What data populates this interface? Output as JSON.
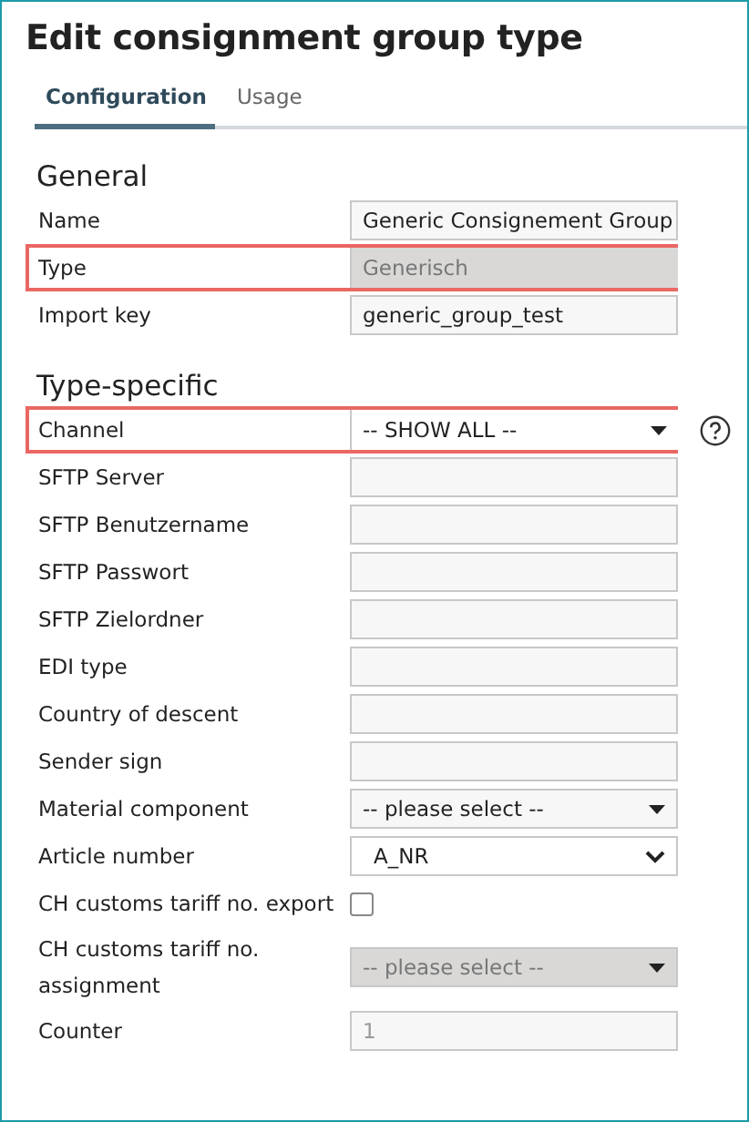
{
  "title": "Edit consignment group type",
  "tabs": [
    {
      "label": "Configuration",
      "selected": true
    },
    {
      "label": "Usage",
      "selected": false
    }
  ],
  "sections": [
    {
      "title": "General",
      "rows": [
        {
          "label": "Name",
          "kind": "text",
          "value": "Generic Consignement Group",
          "disabled": false,
          "readonly": false,
          "highlighted": false,
          "help": false
        },
        {
          "label": "Type",
          "kind": "text",
          "value": "Generisch",
          "disabled": true,
          "readonly": false,
          "highlighted": true,
          "help": false
        },
        {
          "label": "Import key",
          "kind": "text",
          "value": "generic_group_test",
          "disabled": false,
          "readonly": false,
          "highlighted": false,
          "help": false
        }
      ]
    },
    {
      "title": "Type-specific",
      "rows": [
        {
          "label": "Channel",
          "kind": "select",
          "value": "-- SHOW ALL --",
          "disabled": false,
          "highlighted": true,
          "help": true
        },
        {
          "label": "SFTP Server",
          "kind": "text",
          "disabled": false,
          "highlighted": false,
          "help": false
        },
        {
          "label": "SFTP Benutzername",
          "kind": "text",
          "disabled": false,
          "highlighted": false,
          "help": false
        },
        {
          "label": "SFTP Passwort",
          "kind": "text",
          "disabled": false,
          "highlighted": false,
          "help": false
        },
        {
          "label": "SFTP Zielordner",
          "kind": "text",
          "disabled": false,
          "highlighted": false,
          "help": false
        },
        {
          "label": "EDI type",
          "kind": "text",
          "disabled": false,
          "highlighted": false,
          "help": false
        },
        {
          "label": "Country of descent",
          "kind": "text",
          "disabled": false,
          "highlighted": false,
          "help": false
        },
        {
          "label": "Sender sign",
          "kind": "text",
          "disabled": false,
          "highlighted": false,
          "help": false
        },
        {
          "label": "Material component",
          "kind": "select",
          "value": "-- please select --",
          "disabled": false,
          "highlighted": false,
          "help": false
        },
        {
          "label": "Article number",
          "kind": "dropdown",
          "value": "A_NR",
          "disabled": false,
          "highlighted": false,
          "help": false
        },
        {
          "label": "CH customs tariff no. export",
          "kind": "checkbox",
          "checked": false,
          "disabled": false,
          "highlighted": false,
          "help": false
        },
        {
          "label": "CH customs tariff no. assignment",
          "kind": "select",
          "value": "-- please select --",
          "disabled": true,
          "highlighted": false,
          "help": false
        },
        {
          "label": "Counter",
          "kind": "text",
          "value": "1",
          "disabled": false,
          "readonly": true,
          "highlighted": false,
          "help": false
        }
      ]
    }
  ]
}
